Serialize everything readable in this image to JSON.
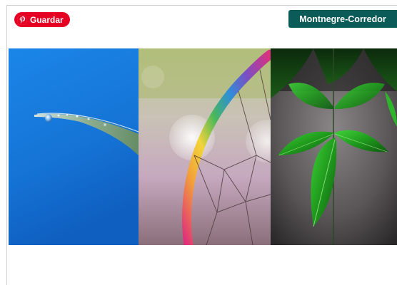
{
  "actions": {
    "save_label": "Guardar"
  },
  "location": {
    "label": "Montnegre-Corredor"
  },
  "icons": {
    "save": "pinterest-icon"
  },
  "colors": {
    "save_button": "#e60023",
    "location_badge": "#0b5b58"
  },
  "gallery": {
    "photos": [
      {
        "subject": "water droplet on grass blade against blue sky"
      },
      {
        "subject": "rainbow dreamcatcher hoop with web and bokeh"
      },
      {
        "subject": "green leaves against dark grey background"
      }
    ]
  }
}
